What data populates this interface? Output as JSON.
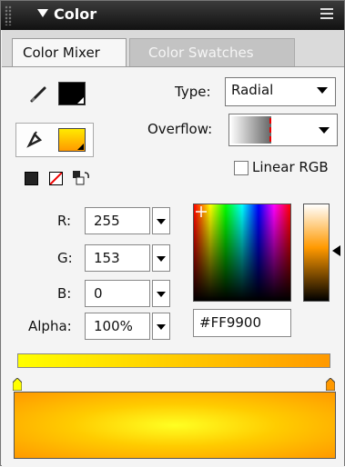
{
  "panel": {
    "title": "Color",
    "tabs": [
      {
        "label": "Color Mixer",
        "active": true
      },
      {
        "label": "Color Swatches",
        "active": false
      }
    ]
  },
  "wells": {
    "stroke_color": "#000000",
    "fill_color": "#ff9900"
  },
  "fill_type": {
    "label": "Type:",
    "value": "Radial"
  },
  "overflow": {
    "label": "Overflow:"
  },
  "linear_rgb": {
    "label": "Linear RGB",
    "checked": false
  },
  "channels": [
    {
      "label": "R:",
      "value": "255"
    },
    {
      "label": "G:",
      "value": "153"
    },
    {
      "label": "B:",
      "value": "0"
    },
    {
      "label": "Alpha:",
      "value": "100%"
    }
  ],
  "hex": {
    "value": "#FF9900"
  },
  "gradient": {
    "stops": [
      {
        "color": "#ffff00",
        "position": 0
      },
      {
        "color": "#ff9900",
        "position": 1
      }
    ]
  },
  "colors": {
    "accent": "#ff9900",
    "gradient_start": "#ffff00",
    "gradient_end": "#ff9900"
  }
}
